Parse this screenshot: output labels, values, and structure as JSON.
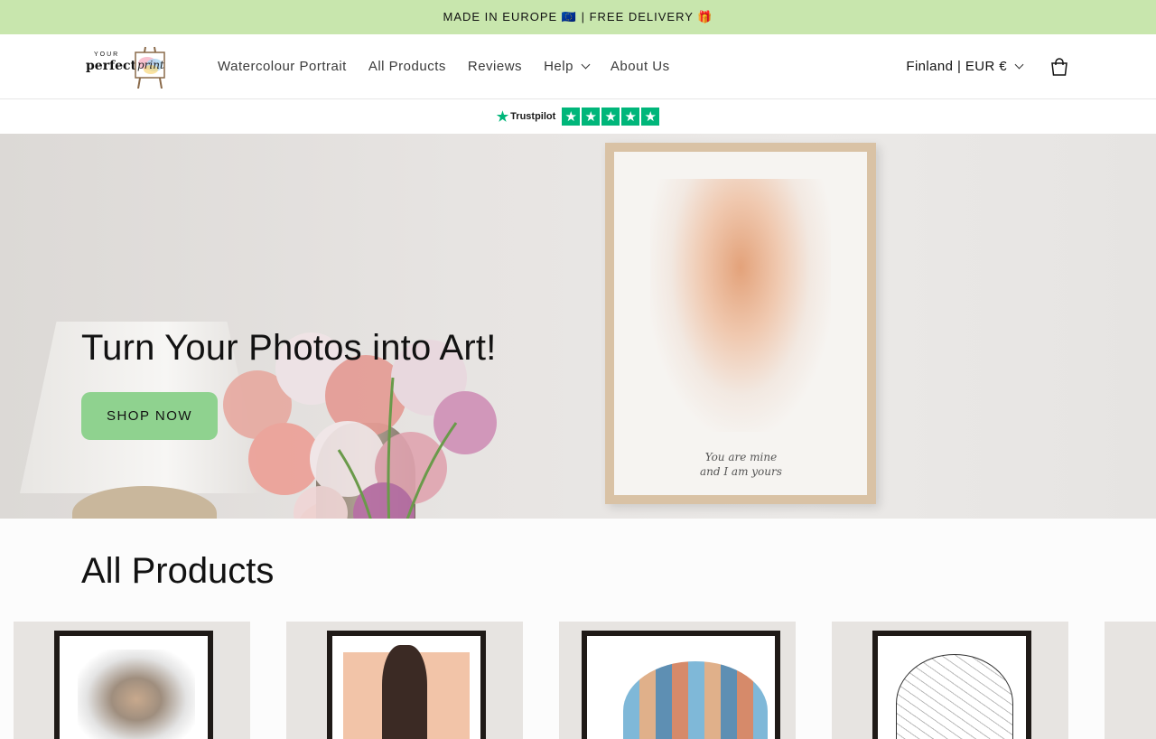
{
  "announcement": "MADE IN EUROPE 🇪🇺 | FREE DELIVERY 🎁",
  "brand": {
    "your": "YOUR",
    "perfect": "perfect",
    "print": "print"
  },
  "nav": {
    "items": [
      {
        "label": "Watercolour Portrait"
      },
      {
        "label": "All Products"
      },
      {
        "label": "Reviews"
      },
      {
        "label": "Help"
      },
      {
        "label": "About Us"
      }
    ]
  },
  "locale": "Finland | EUR €",
  "trustpilot": {
    "label": "Trustpilot",
    "rating": 5
  },
  "hero": {
    "title": "Turn Your Photos into Art!",
    "button": "SHOP NOW",
    "quote_line1": "You are mine",
    "quote_line2": "and I am yours"
  },
  "section": {
    "title": "All Products"
  },
  "colors": {
    "announcement_bg": "#c8e6ad",
    "button_bg": "#8fd28f",
    "trustpilot": "#00b67a"
  }
}
